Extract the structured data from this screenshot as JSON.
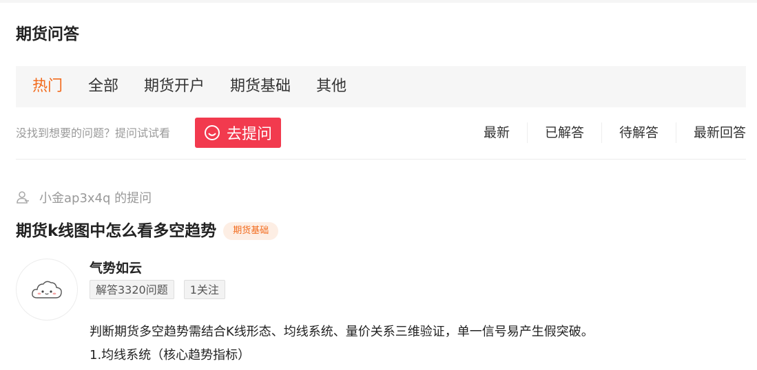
{
  "page": {
    "title": "期货问答"
  },
  "tabs": [
    {
      "label": "热门",
      "active": true
    },
    {
      "label": "全部"
    },
    {
      "label": "期货开户"
    },
    {
      "label": "期货基础"
    },
    {
      "label": "其他"
    }
  ],
  "ask": {
    "hint": "没找到想要的问题？提问试试看",
    "button_label": "去提问",
    "button_icon": "smile-icon"
  },
  "filters": [
    {
      "label": "最新"
    },
    {
      "label": "已解答"
    },
    {
      "label": "待解答"
    },
    {
      "label": "最新回答"
    }
  ],
  "question": {
    "asker_icon": "user-icon",
    "asker": "小金ap3x4q 的提问",
    "title": "期货k线图中怎么看多空趋势",
    "tag": "期货基础"
  },
  "answerer": {
    "avatar_icon": "cloud-avatar-icon",
    "name": "气势如云",
    "answers_badge": "解答3320问题",
    "follow_badge": "1关注"
  },
  "answer": {
    "lines": [
      "判断期货多空趋势需结合K线形态、均线系统、量价关系三维验证，单一信号易产生假突破。",
      "1.均线系统（核心趋势指标）"
    ]
  },
  "colors": {
    "accent_orange": "#f26b1d",
    "ask_button_red": "#f23a4e",
    "tag_bg": "#fdeee4"
  }
}
